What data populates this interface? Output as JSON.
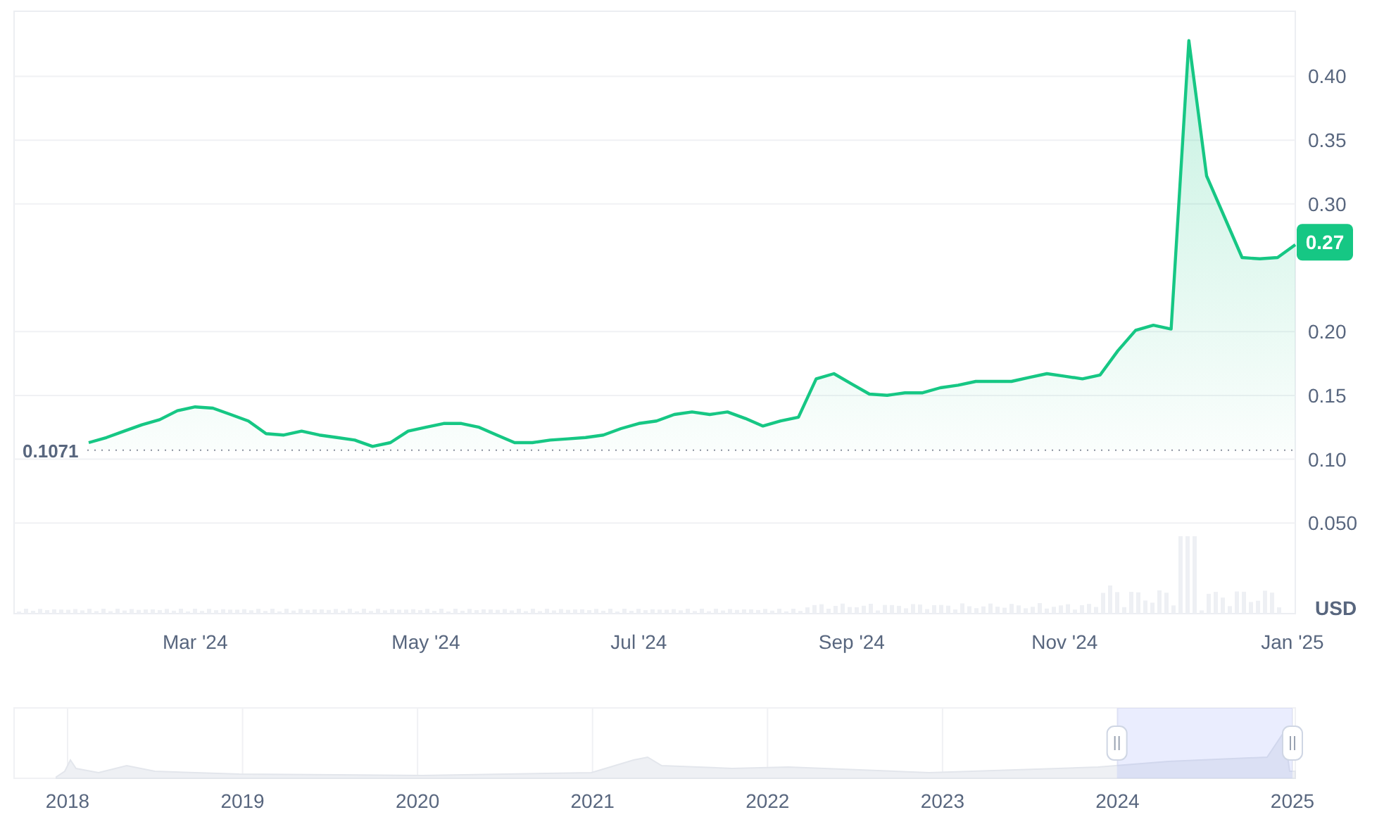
{
  "chart": {
    "chart_data": {
      "type": "area",
      "ylabel": "USD",
      "grid": true,
      "categories": [
        null,
        null,
        null,
        null,
        null,
        null,
        "Mar '24",
        null,
        null,
        null,
        null,
        null,
        null,
        null,
        null,
        null,
        null,
        null,
        null,
        "May '24",
        null,
        null,
        null,
        null,
        null,
        null,
        null,
        null,
        null,
        null,
        null,
        "Jul '24",
        null,
        null,
        null,
        null,
        null,
        null,
        null,
        null,
        null,
        null,
        null,
        "Sep '24",
        null,
        null,
        null,
        null,
        null,
        null,
        null,
        null,
        null,
        null,
        null,
        "Nov '24",
        null,
        null,
        null,
        null,
        null,
        null,
        null,
        null,
        null,
        null,
        null,
        null,
        "Jan '25"
      ],
      "series": [
        {
          "color": "#16c784",
          "values": [
            0.113,
            0.117,
            0.122,
            0.127,
            0.131,
            0.138,
            0.141,
            0.14,
            0.135,
            0.13,
            0.12,
            0.119,
            0.122,
            0.119,
            0.117,
            0.115,
            0.11,
            0.113,
            0.122,
            0.125,
            0.128,
            0.128,
            0.125,
            0.119,
            0.113,
            0.113,
            0.115,
            0.116,
            0.117,
            0.119,
            0.124,
            0.128,
            0.13,
            0.135,
            0.137,
            0.135,
            0.137,
            0.132,
            0.126,
            0.13,
            0.133,
            0.163,
            0.167,
            0.159,
            0.151,
            0.15,
            0.152,
            0.152,
            0.156,
            0.158,
            0.161,
            0.161,
            0.161,
            0.164,
            0.167,
            0.165,
            0.163,
            0.166,
            0.185,
            0.201,
            0.205,
            0.202,
            0.428,
            0.322,
            0.29,
            0.258,
            0.257,
            0.258,
            0.268
          ]
        }
      ],
      "ylim": [
        -0.021,
        0.451
      ],
      "yticks": [
        {
          "value": 0.4,
          "label": "0.40"
        },
        {
          "value": 0.35,
          "label": "0.35"
        },
        {
          "value": 0.3,
          "label": "0.30"
        },
        {
          "value": 0.2,
          "label": "0.20"
        },
        {
          "value": 0.15,
          "label": "0.15"
        },
        {
          "value": 0.1,
          "label": "0.10"
        },
        {
          "value": 0.05,
          "label": "0.050"
        }
      ],
      "ref_lines": [
        {
          "axis": "y",
          "value": 0.1071,
          "label": "0.1071"
        }
      ],
      "annotations": [
        {
          "y": 0.27,
          "text": "0.27"
        }
      ]
    }
  },
  "navigator": {
    "years": [
      "2018",
      "2019",
      "2020",
      "2021",
      "2022",
      "2023",
      "2024",
      "2025"
    ],
    "level": 0.137
  }
}
